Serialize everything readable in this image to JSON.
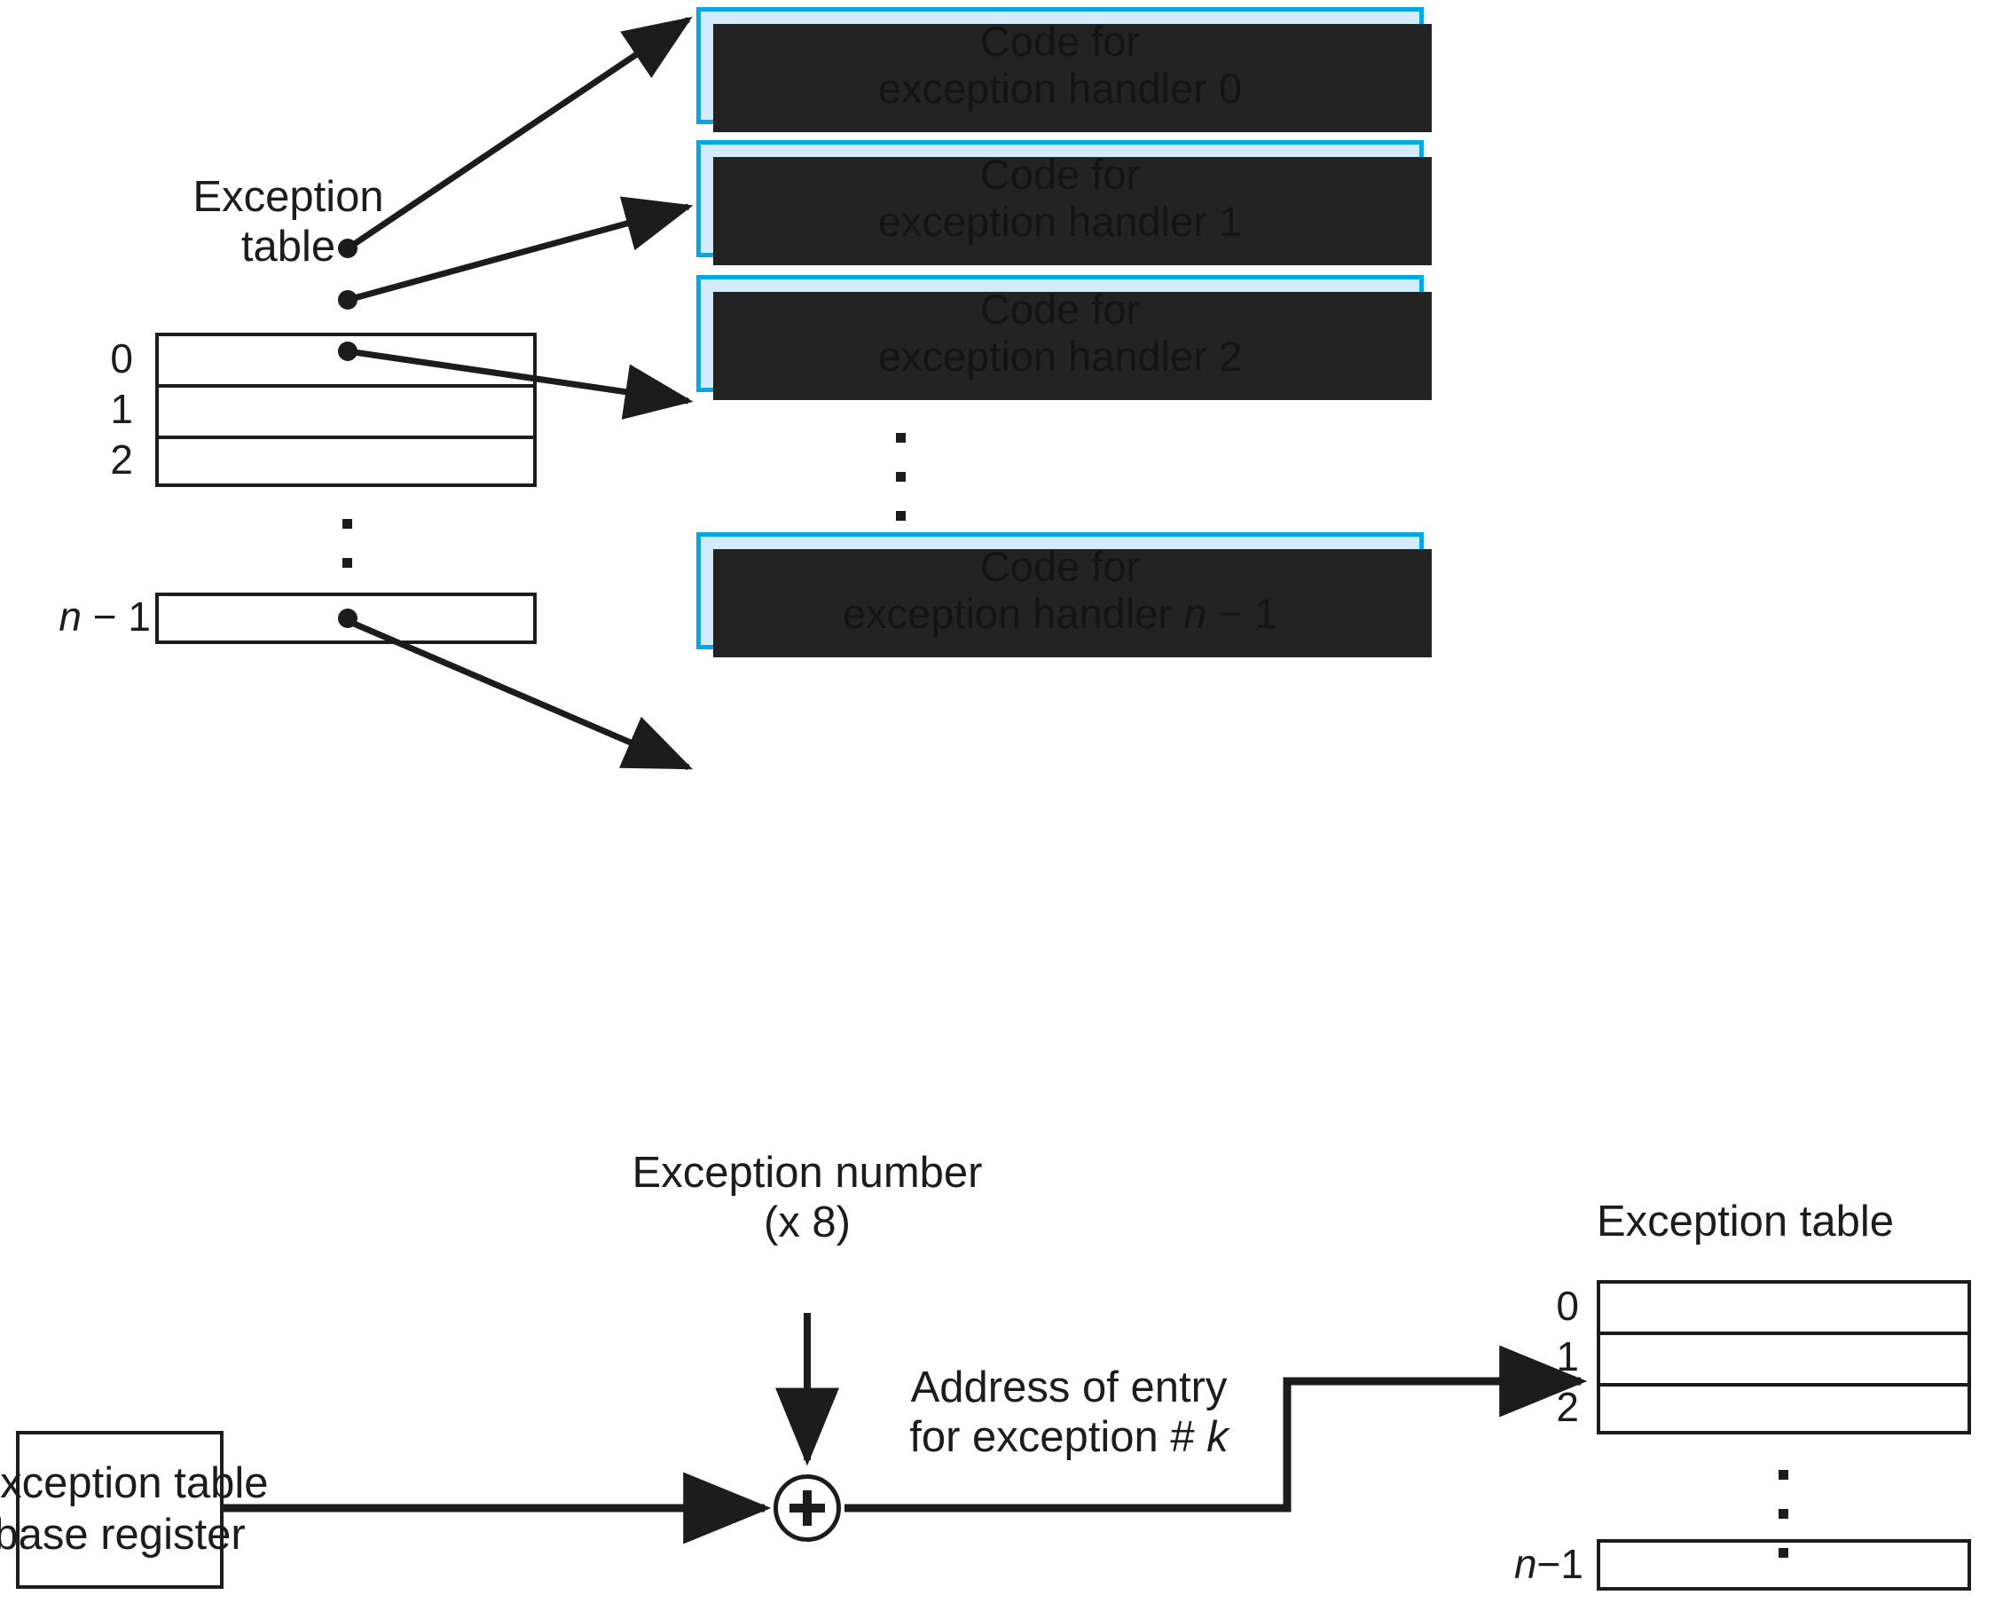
{
  "diagram": {
    "top": {
      "table_title": "Exception\ntable",
      "table_title_line1": "Exception",
      "table_title_line2": "table",
      "row_labels": [
        "0",
        "1",
        "2"
      ],
      "last_row_label_n": "n",
      "last_row_label_rest": " − 1",
      "handlers": [
        {
          "line1": "Code for",
          "line2": "exception handler 0"
        },
        {
          "line1": "Code for",
          "line2": "exception handler 1"
        },
        {
          "line1": "Code for",
          "line2": "exception handler 2"
        },
        {
          "line1": "Code for",
          "line2_prefix": "exception handler ",
          "line2_italic": "n",
          "line2_suffix": " − 1"
        }
      ],
      "ellipsis_glyph": "▪"
    },
    "bottom": {
      "exception_number_line1": "Exception number",
      "exception_number_line2": "(x 8)",
      "address_line1": "Address of entry",
      "address_line2_prefix": "for exception # ",
      "address_line2_italic": "k",
      "base_register_line1": "Exception table",
      "base_register_line2": "base register",
      "adder_symbol": "+",
      "table_title": "Exception table",
      "row_labels": [
        "0",
        "1",
        "2"
      ],
      "last_row_label_n": "n",
      "last_row_label_rest": "−1"
    }
  },
  "colors": {
    "box_fill": "#d3ecfb",
    "box_border": "#00a9e6",
    "box_shadow": "#232323",
    "ink": "#1c1c1c",
    "page": "#ffffff"
  }
}
